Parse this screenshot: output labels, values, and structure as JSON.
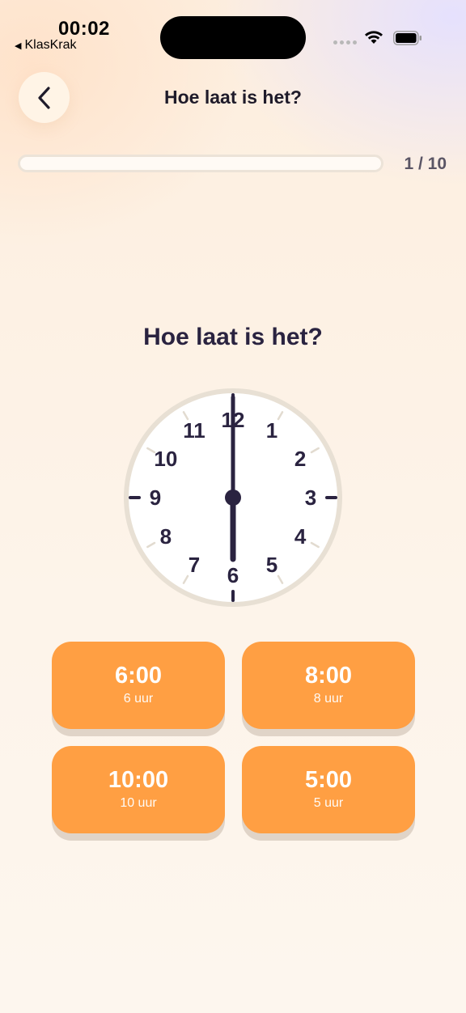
{
  "status_bar": {
    "time": "00:02",
    "back_app_label": "KlasKrak"
  },
  "header": {
    "title": "Hoe laat is het?"
  },
  "progress": {
    "label": "1 / 10",
    "fraction": 0
  },
  "question": {
    "text": "Hoe laat is het?"
  },
  "clock": {
    "hour": 6,
    "minute": 0,
    "numbers": [
      "12",
      "1",
      "2",
      "3",
      "4",
      "5",
      "6",
      "7",
      "8",
      "9",
      "10",
      "11"
    ]
  },
  "answers": [
    {
      "time": "6:00",
      "label": "6 uur"
    },
    {
      "time": "8:00",
      "label": "8 uur"
    },
    {
      "time": "10:00",
      "label": "10 uur"
    },
    {
      "time": "5:00",
      "label": "5 uur"
    }
  ],
  "colors": {
    "accent": "#ff9f43",
    "text_dark": "#2a2340",
    "clock_rim": "#e8e0d4"
  }
}
